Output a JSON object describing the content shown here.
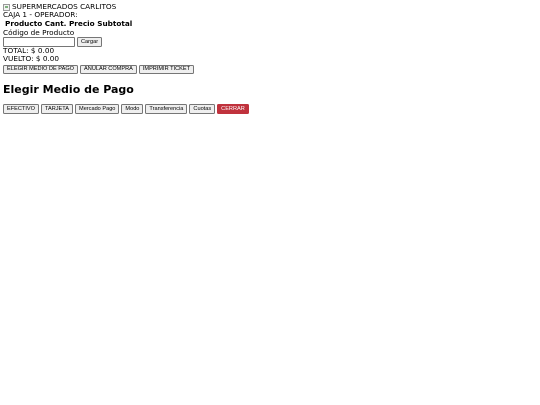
{
  "store": {
    "name": "SUPERMERCADOS CARLITOS",
    "caja_line": "CAJA 1 - OPERADOR:"
  },
  "table": {
    "headers": [
      "Producto",
      "Cant.",
      "Precio",
      "Subtotal"
    ]
  },
  "product_code": {
    "label": "Código de Producto",
    "value": "",
    "load_button": "Cargar"
  },
  "totals": {
    "total": "TOTAL: $ 0.00",
    "vuelto": "VUELTO: $ 0.00"
  },
  "actions": {
    "payment_method": "ELEGIR MEDIO DE PAGO",
    "cancel": "ANULAR COMPRA",
    "print": "IMPRIMIR TICKET"
  },
  "payment_modal": {
    "title": "Elegir Medio de Pago",
    "options": [
      "EFECTIVO",
      "TARJETA",
      "Mercado Pago",
      "Modo",
      "Transferencia",
      "Cuotas"
    ],
    "close": "CERRAR",
    "close_color": "#c0323d"
  }
}
